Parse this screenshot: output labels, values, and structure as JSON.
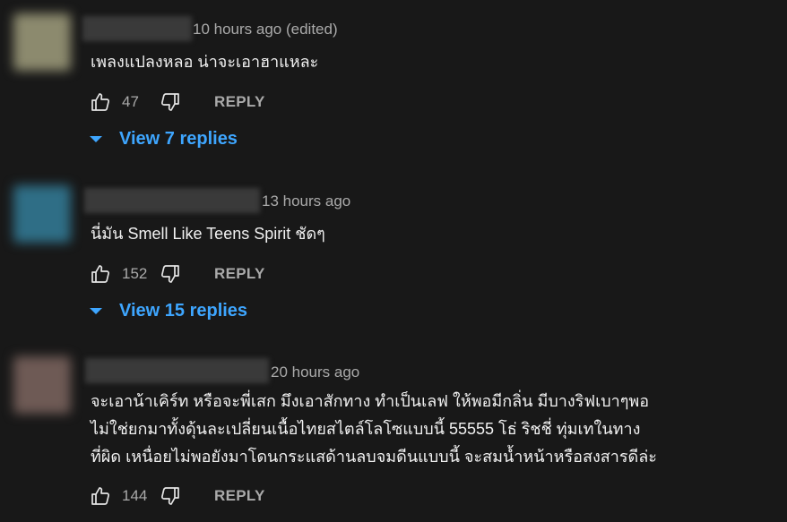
{
  "comments": [
    {
      "time": "10 hours ago (edited)",
      "text": "เพลงแปลงหลอ น่าจะเอาฮาแหละ",
      "likes": "47",
      "reply_label": "REPLY",
      "view_replies": "View 7 replies",
      "avatar_color": "#8c8a6e"
    },
    {
      "time": "13 hours ago",
      "text": "นี่มัน Smell Like Teens Spirit ชัดๆ",
      "likes": "152",
      "reply_label": "REPLY",
      "view_replies": "View 15 replies",
      "avatar_color": "#2f6e86"
    },
    {
      "time": "20 hours ago",
      "text_lines": [
        "จะเอาน้าเคิร์ท หรือจะพี่เสก มึงเอาสักทาง ทำเป็นเลฟ ให้พอมีกลิ่น มีบางริฟเบาๆพอ",
        "ไม่ใช่ยกมาทั้งดุ้นละเปลี่ยนเนื้อไทยสไตล์โลโซแบบนี้  55555  โธ่ ริชชี่ ทุ่มเทในทาง",
        "ที่ผิด เหนื่อยไม่พอยังมาโดนกระแสด้านลบจมดีนแบบนี้  จะสมน้ำหน้าหรือสงสารดีล่ะ"
      ],
      "likes": "144",
      "reply_label": "REPLY",
      "avatar_color": "#6e5a55"
    }
  ]
}
